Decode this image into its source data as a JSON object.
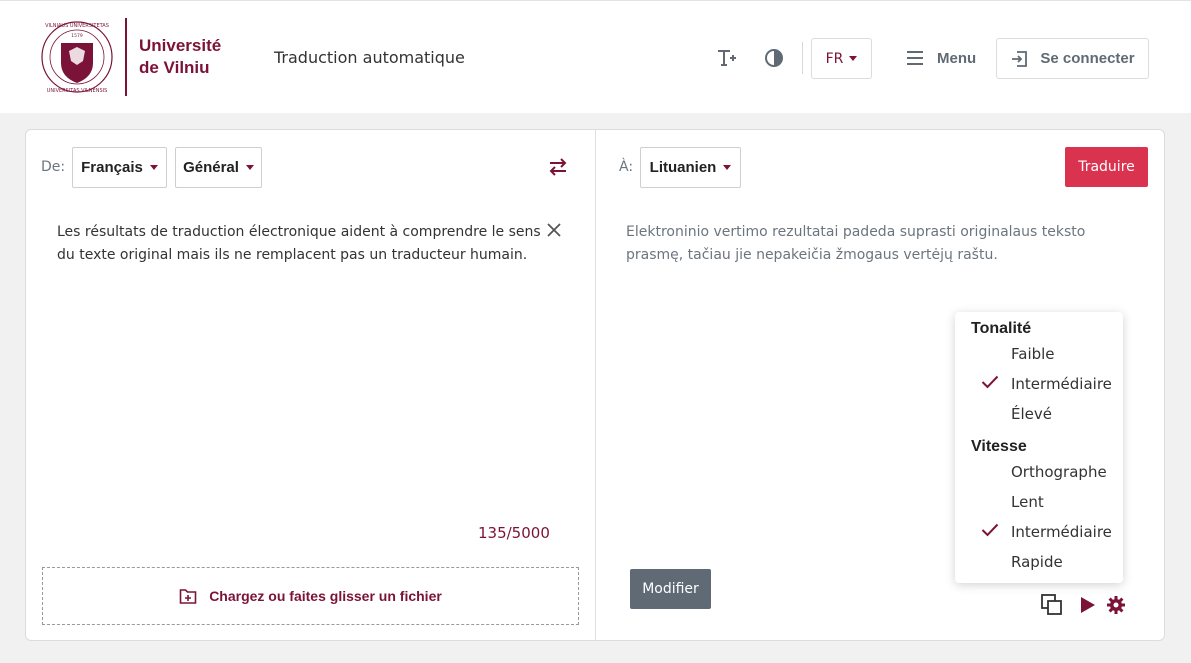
{
  "header": {
    "logo_line1": "Université",
    "logo_line2": "de Vilniu",
    "app_title": "Traduction automatique",
    "language": "FR",
    "menu_label": "Menu",
    "login_label": "Se connecter"
  },
  "source": {
    "label": "De:",
    "language": "Français",
    "domain": "Général",
    "text": "Les résultats de traduction électronique aident à comprendre le sens du texte original mais ils ne remplacent pas un traducteur humain.",
    "counter": "135/5000",
    "upload_label": "Chargez ou faites glisser un fichier"
  },
  "target": {
    "label": "À:",
    "language": "Lituanien",
    "translate_label": "Traduire",
    "text": "Elektroninio vertimo rezultatai padeda suprasti originalaus teksto prasmę, tačiau jie nepakeičia žmogaus vertėjų raštu.",
    "modify_label": "Modifier"
  },
  "options_menu": {
    "tone_heading": "Tonalité",
    "tone_items": [
      {
        "label": "Faible",
        "checked": false
      },
      {
        "label": "Intermédiaire",
        "checked": true
      },
      {
        "label": "Élevé",
        "checked": false
      }
    ],
    "speed_heading": "Vitesse",
    "speed_items": [
      {
        "label": "Orthographe",
        "checked": false
      },
      {
        "label": "Lent",
        "checked": false
      },
      {
        "label": "Intermédiaire",
        "checked": true
      },
      {
        "label": "Rapide",
        "checked": false
      }
    ]
  },
  "colors": {
    "brand": "#7b1339",
    "translate_button": "#d9334f",
    "modify_button": "#5f6a75"
  }
}
